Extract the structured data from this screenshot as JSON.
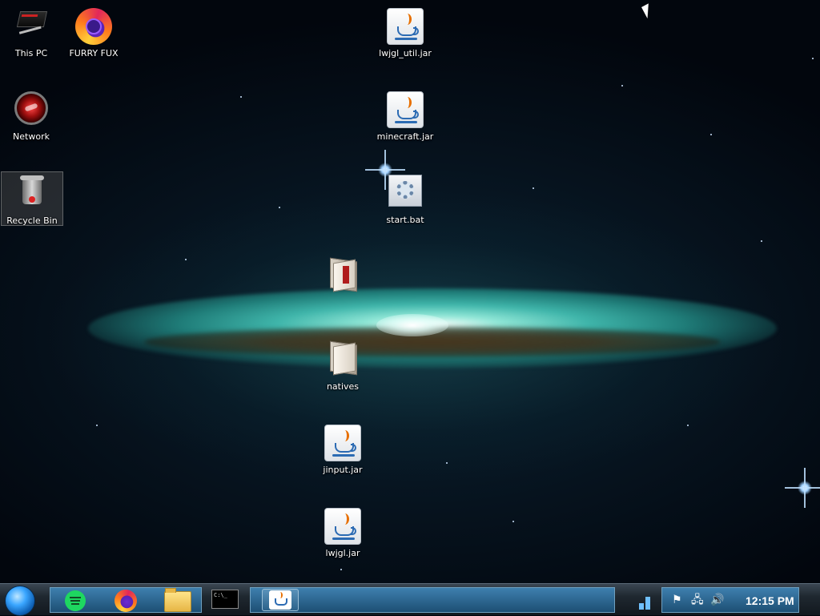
{
  "desktop": {
    "icons": [
      {
        "label": "This PC"
      },
      {
        "label": "FURRY FUX"
      },
      {
        "label": "Network"
      },
      {
        "label": "Recycle Bin"
      },
      {
        "label": "lwjgl_util.jar"
      },
      {
        "label": "minecraft.jar"
      },
      {
        "label": "start.bat"
      },
      {
        "label": ""
      },
      {
        "label": "natives"
      },
      {
        "label": "jinput.jar"
      },
      {
        "label": "lwjgl.jar"
      }
    ]
  },
  "taskbar": {
    "start_icon": "start-orb",
    "pinned": [
      {
        "name": "spotify",
        "icon": "spotify-icon"
      },
      {
        "name": "firefox",
        "icon": "firefox-icon"
      },
      {
        "name": "file-explorer",
        "icon": "folder-icon"
      }
    ],
    "cmd_text": "C:\\_",
    "running_app_icon": "java-icon",
    "tray": {
      "icons": [
        "flag-icon",
        "network-icon",
        "volume-icon"
      ],
      "clock": "12:15 PM"
    }
  },
  "colors": {
    "taskbar_accent": "#3e7fae",
    "java_orange": "#e76f00",
    "java_blue": "#2c6bb3"
  }
}
